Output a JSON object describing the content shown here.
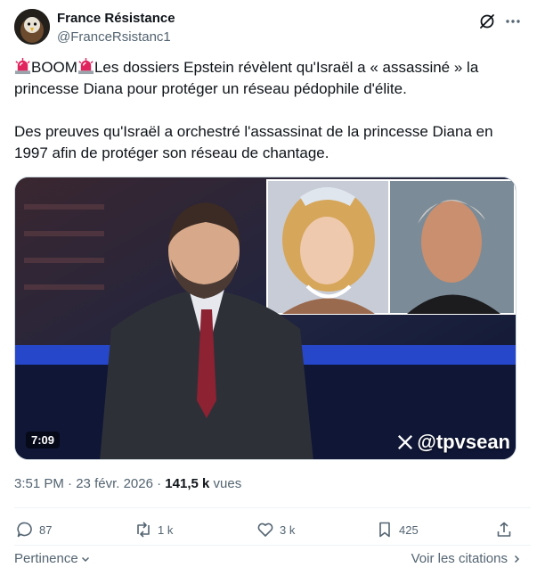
{
  "author": {
    "name": "France Résistance",
    "handle": "@FranceRsistanc1"
  },
  "tweet": {
    "line1_a": "BOOM",
    "line1_b": "Les dossiers Epstein révèlent qu'Israël a « assassiné » la princesse Diana pour protéger un réseau pédophile d'élite.",
    "paragraph2": "Des preuves qu'Israël a orchestré l'assassinat de la princesse Diana en 1997 afin de protéger son réseau de chantage.",
    "leading_icon": "rotating-light-icon"
  },
  "media": {
    "duration": "7:09",
    "watermark": "@tpvsean"
  },
  "meta": {
    "time": "3:51 PM",
    "separator": " · ",
    "date": "23 févr. 2026",
    "views_count": "141,5 k",
    "views_label": "vues"
  },
  "actions": {
    "replies": "87",
    "reposts": "1 k",
    "likes": "3 k",
    "bookmarks": "425"
  },
  "footer": {
    "relevance": "Pertinence",
    "quotes": "Voir les citations"
  },
  "colors": {
    "text": "#0f1419",
    "secondary": "#536471",
    "divider": "#eff3f4",
    "siren": "#e0245e"
  }
}
